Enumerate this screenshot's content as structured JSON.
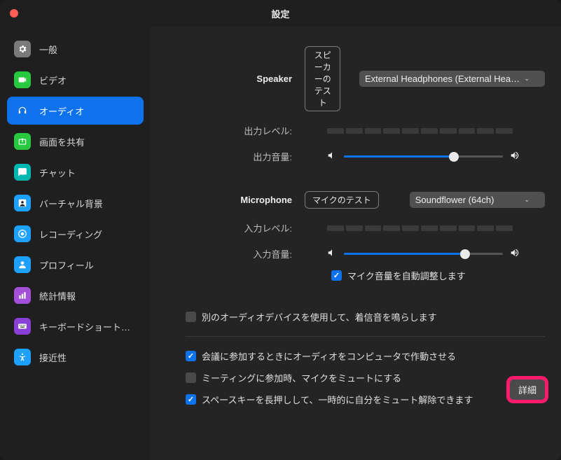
{
  "window": {
    "title": "設定"
  },
  "sidebar": {
    "items": [
      {
        "label": "一般",
        "icon": "gear",
        "bg": "#7a7a7a"
      },
      {
        "label": "ビデオ",
        "icon": "video",
        "bg": "#28c940"
      },
      {
        "label": "オーディオ",
        "icon": "headphones",
        "bg": "#0e72ec",
        "active": true
      },
      {
        "label": "画面を共有",
        "icon": "share",
        "bg": "#28c940"
      },
      {
        "label": "チャット",
        "icon": "chat",
        "bg": "#00b8b0"
      },
      {
        "label": "バーチャル背景",
        "icon": "virtual-bg",
        "bg": "#1ea0ff"
      },
      {
        "label": "レコーディング",
        "icon": "record",
        "bg": "#1ea0ff"
      },
      {
        "label": "プロフィール",
        "icon": "profile",
        "bg": "#1ea0ff"
      },
      {
        "label": "統計情報",
        "icon": "stats",
        "bg": "#a34fd8"
      },
      {
        "label": "キーボードショートカ…",
        "icon": "keyboard",
        "bg": "#8a3fd6"
      },
      {
        "label": "接近性",
        "icon": "accessibility",
        "bg": "#1ea0ff"
      }
    ]
  },
  "speaker": {
    "section_label": "Speaker",
    "test_button": "スピーカーのテスト",
    "device": "External Headphones (External Headph…",
    "output_level_label": "出力レベル:",
    "output_volume_label": "出力音量:",
    "output_volume_pct": 69
  },
  "microphone": {
    "section_label": "Microphone",
    "test_button": "マイクのテスト",
    "device": "Soundflower (64ch)",
    "input_level_label": "入力レベル:",
    "input_volume_label": "入力音量:",
    "input_volume_pct": 76,
    "auto_adjust_label": "マイク音量を自動調整します",
    "auto_adjust_checked": true
  },
  "options": {
    "separate_ringtone": {
      "label": "別のオーディオデバイスを使用して、着信音を鳴らします",
      "checked": false
    },
    "join_audio_by_computer": {
      "label": "会議に参加するときにオーディオをコンピュータで作動させる",
      "checked": true
    },
    "mute_on_join": {
      "label": "ミーティングに参加時、マイクをミュートにする",
      "checked": false
    },
    "space_unmute": {
      "label": "スペースキーを長押しして、一時的に自分をミュート解除できます",
      "checked": true
    }
  },
  "advanced_button": "詳細"
}
